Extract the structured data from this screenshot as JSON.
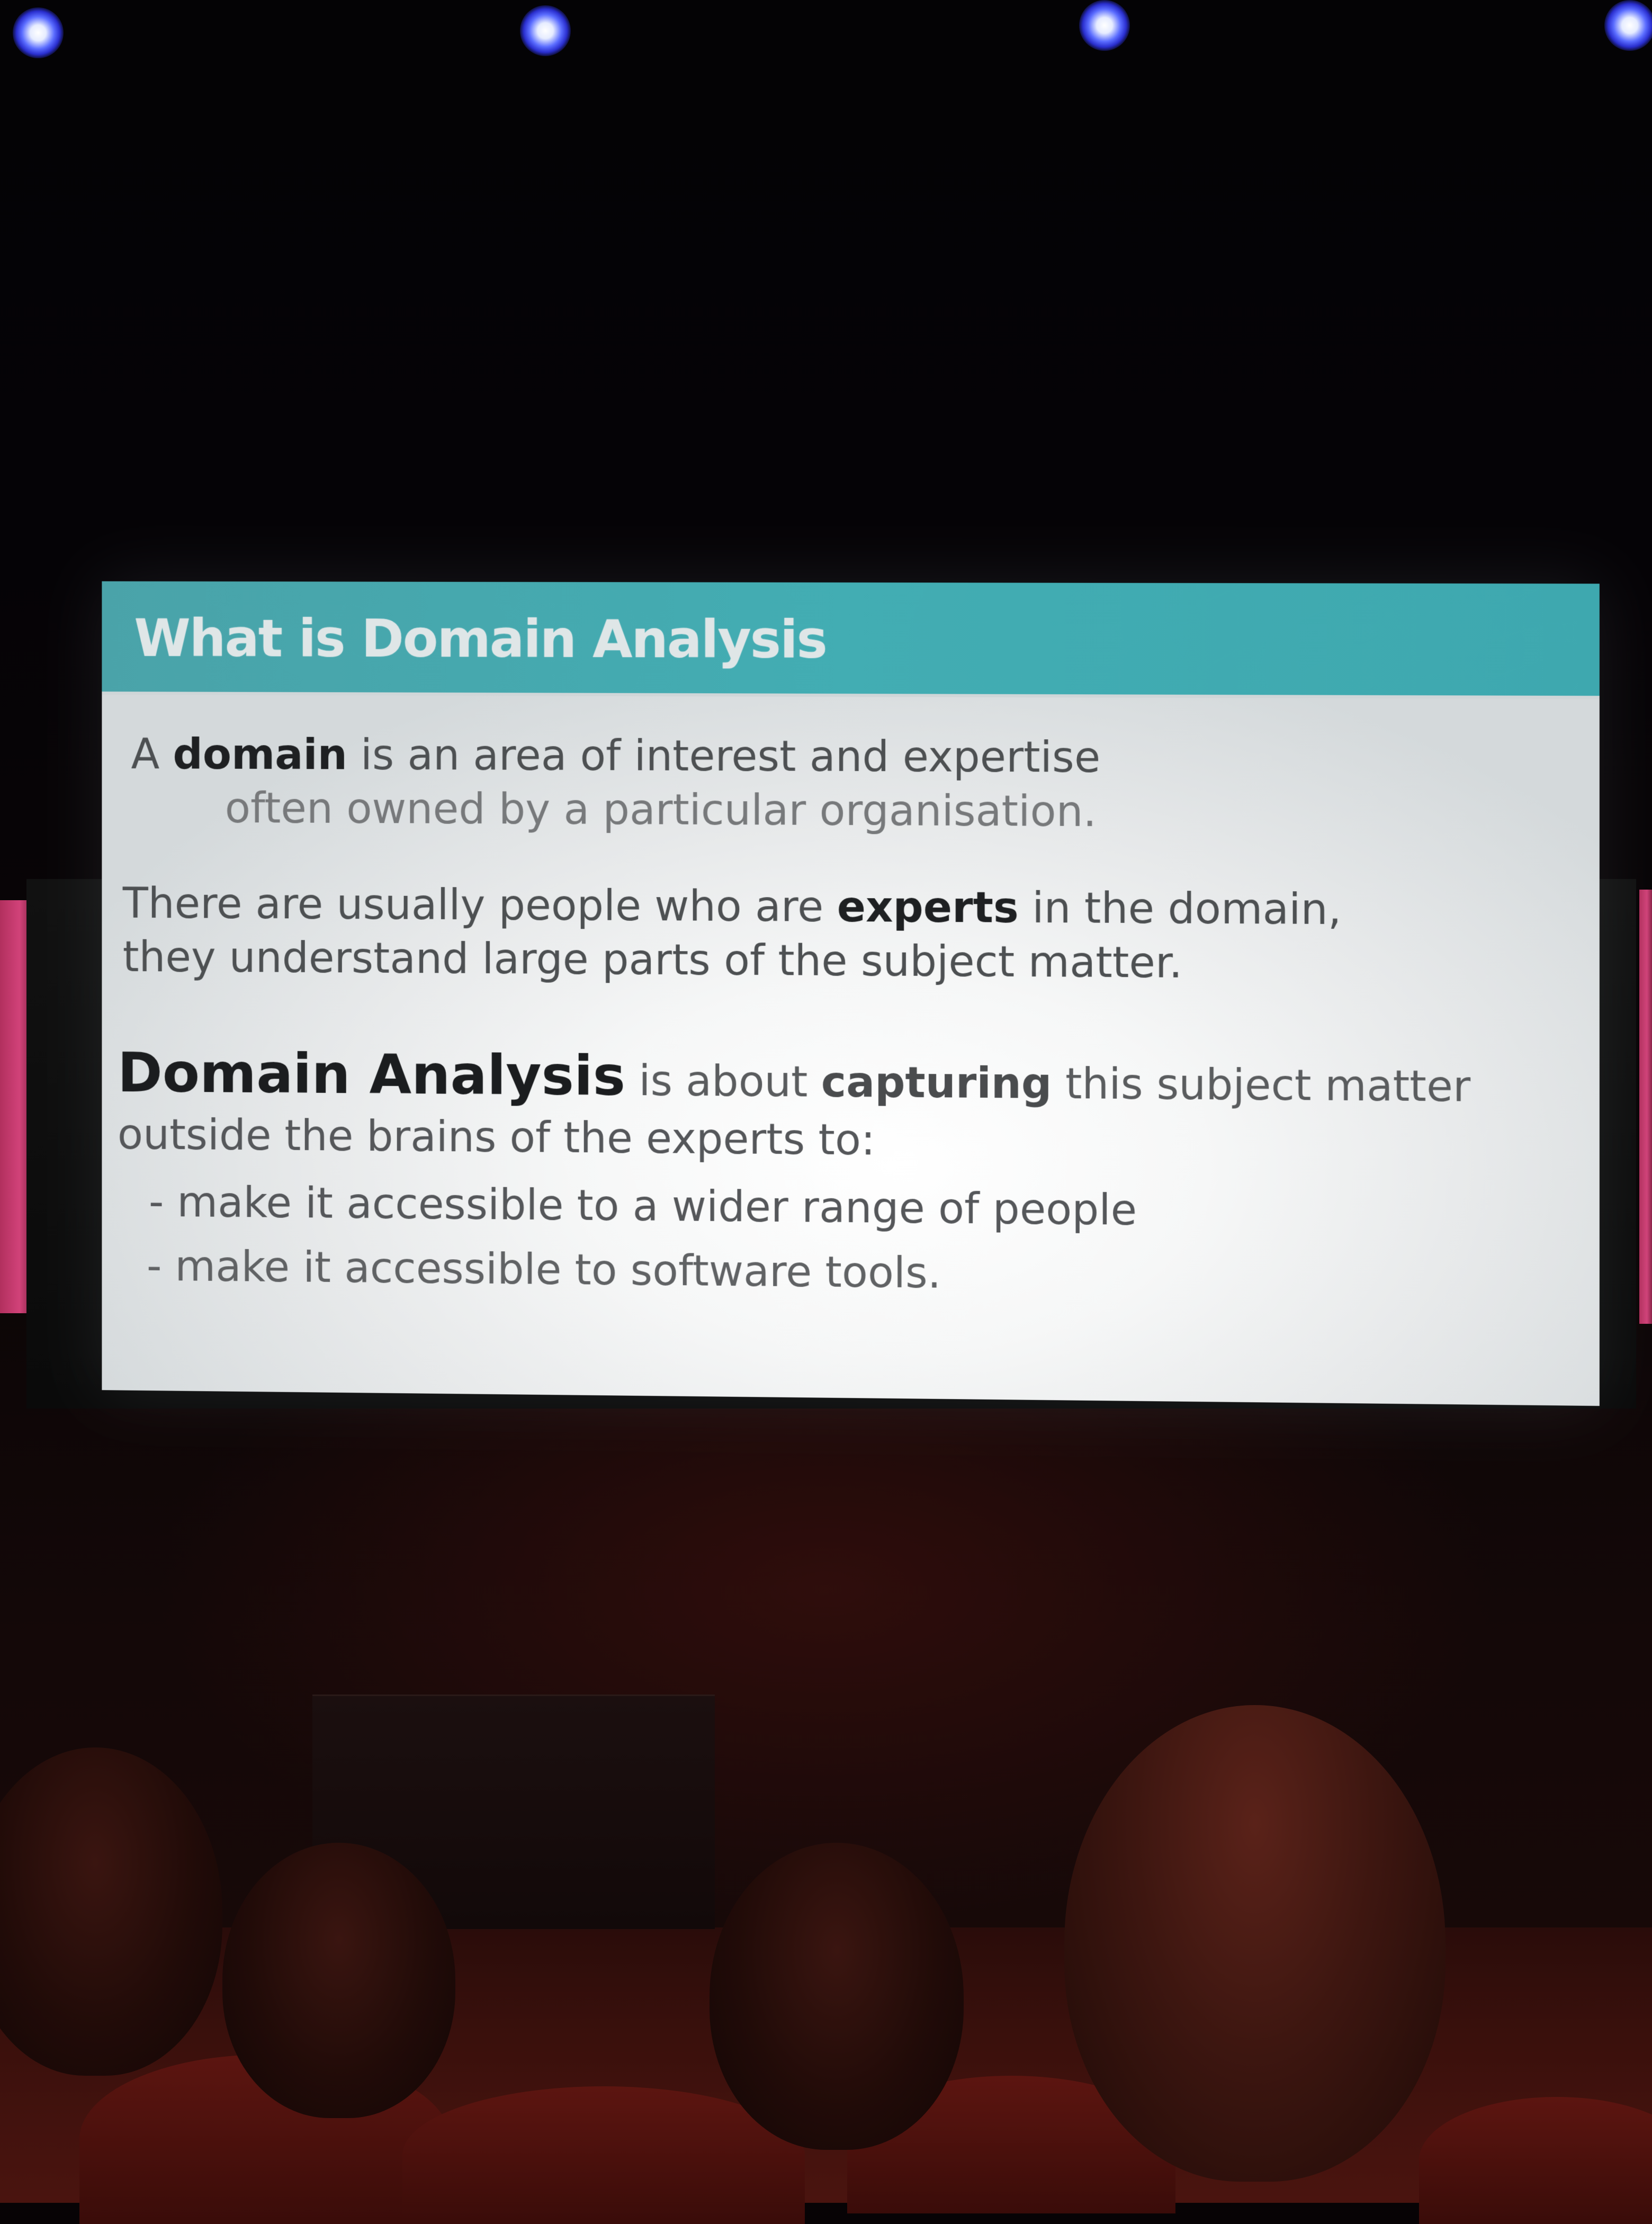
{
  "slide": {
    "title": "What is Domain Analysis",
    "para1": {
      "line1_prefix": "A ",
      "line1_bold": "domain",
      "line1_suffix": " is an area of interest and expertise",
      "line2": "often owned by a particular organisation."
    },
    "para2": {
      "line1_prefix": "There are usually people who are ",
      "line1_bold": "experts",
      "line1_suffix": " in the domain,",
      "line2": "they understand large parts of the subject matter."
    },
    "para3": {
      "line1_bold": "Domain Analysis",
      "line1_mid": " is about ",
      "line1_bold2": "capturing",
      "line1_suffix": " this subject matter",
      "line2": "outside the brains of the experts to:"
    },
    "bullets": [
      "- make it accessible to a wider range of people",
      "- make it accessible to software tools."
    ]
  },
  "colors": {
    "header_teal": "#42adb3",
    "slide_bg": "#f6f7f7",
    "accent_pink": "#d14279",
    "ceiling_light_blue": "#5a6cff"
  }
}
